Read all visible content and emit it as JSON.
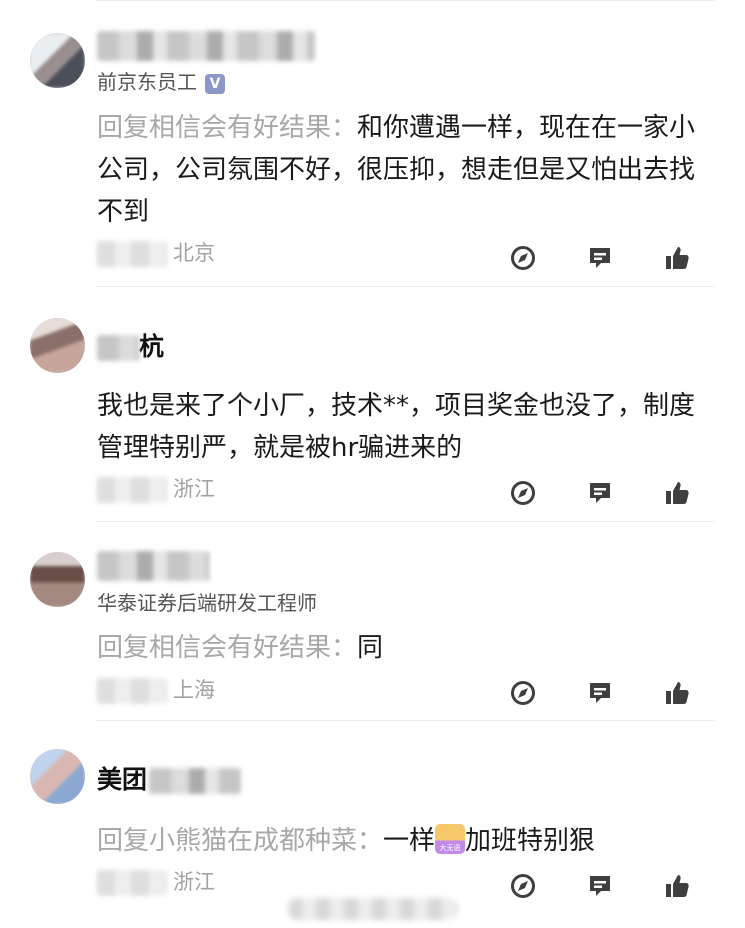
{
  "comments": [
    {
      "subtitle": "前京东员工",
      "badge": "V",
      "reply_prefix": "回复相信会有好结果：",
      "text": "和你遭遇一样，现在在一家小公司，公司氛围不好，很压抑，想走但是又怕出去找不到",
      "location": "北京"
    },
    {
      "name_visible": "杭",
      "text": "我也是来了个小厂，技术**，项目奖金也没了，制度管理特别严，就是被hr骗进来的",
      "location": "浙江"
    },
    {
      "subtitle": "华泰证券后端研发工程师",
      "reply_prefix": "回复相信会有好结果：",
      "text": "同",
      "location": "上海"
    },
    {
      "name_visible": "美团",
      "reply_prefix": "回复小熊猫在成都种菜：",
      "text_before": "一样",
      "emoji_label": "大无语",
      "text_after": "加班特别狠",
      "location": "浙江"
    }
  ],
  "actions": {
    "reply_icon": "compass-reply-icon",
    "comment_icon": "comment-bubble-icon",
    "like_icon": "thumbs-up-icon"
  },
  "colors": {
    "badge": "#8d96c8",
    "muted": "#a8a8a8",
    "icon": "#3f3f3f"
  }
}
